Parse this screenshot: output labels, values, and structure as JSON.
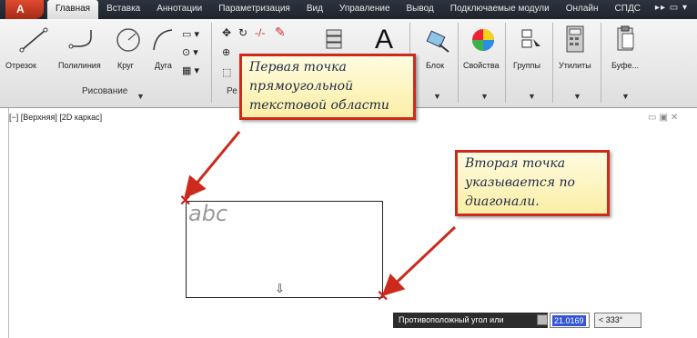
{
  "ribbon": {
    "tabs": [
      "Главная",
      "Вставка",
      "Аннотации",
      "Параметризация",
      "Вид",
      "Управление",
      "Вывод",
      "Подключаемые модули",
      "Онлайн",
      "СПДС"
    ],
    "active_tab": 0,
    "draw_tools": {
      "line": "Отрезок",
      "polyline": "Полилиния",
      "circle": "Круг",
      "arc": "Дуга"
    },
    "draw_panel_label": "Рисование",
    "modify_panel_label": "Ре",
    "block_label": "Блок",
    "properties_label": "Свойства",
    "groups_label": "Группы",
    "utilities_label": "Утилиты",
    "clipboard_label": "Буфе..."
  },
  "viewport": {
    "label": "[−] [Верхняя] [2D каркас]"
  },
  "drawing": {
    "mtext": "abc"
  },
  "callouts": {
    "first": [
      "Первая точка",
      "прямоугольной",
      "текстовой области"
    ],
    "second": [
      "Вторая точка",
      "указывается по",
      "диагонали."
    ]
  },
  "dynamic_input": {
    "prompt": "Противоположный угол или",
    "value": "21.0169",
    "angle": "< 333°"
  },
  "colors": {
    "callout_border": "#cc2a1c",
    "callout_fill": "#fdf5c4",
    "arrow": "#cc2a1c"
  }
}
